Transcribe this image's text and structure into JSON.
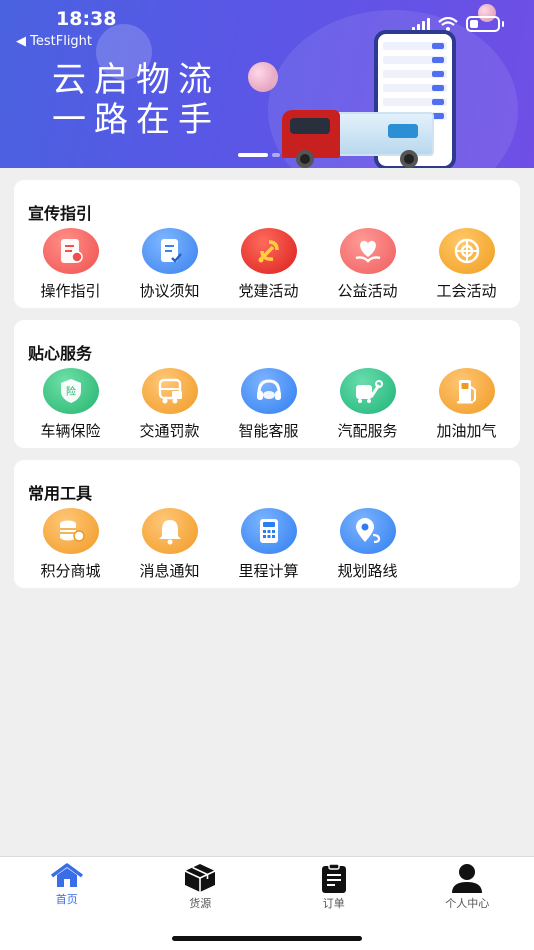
{
  "status_bar": {
    "time": "18:38",
    "back_app": "◀ TestFlight"
  },
  "banner": {
    "line1": "云启物流",
    "line2": "一路在手"
  },
  "sections": [
    {
      "title": "宣传指引",
      "items": [
        {
          "label": "操作指引",
          "icon": "guide-icon",
          "color": "#f25a5a"
        },
        {
          "label": "协议须知",
          "icon": "agreement-icon",
          "color": "#3f8df0"
        },
        {
          "label": "党建活动",
          "icon": "party-emblem-icon",
          "color": "#e8332c"
        },
        {
          "label": "公益活动",
          "icon": "charity-heart-icon",
          "color": "#f06565"
        },
        {
          "label": "工会活动",
          "icon": "union-emblem-icon",
          "color": "#f2a531"
        }
      ]
    },
    {
      "title": "贴心服务",
      "items": [
        {
          "label": "车辆保险",
          "icon": "insurance-shield-icon",
          "color": "#34c27e"
        },
        {
          "label": "交通罚款",
          "icon": "traffic-fine-icon",
          "color": "#f4a437"
        },
        {
          "label": "智能客服",
          "icon": "headset-icon",
          "color": "#3d88f2"
        },
        {
          "label": "汽配服务",
          "icon": "auto-parts-icon",
          "color": "#2fc38a"
        },
        {
          "label": "加油加气",
          "icon": "fuel-pump-icon",
          "color": "#f2a23a"
        }
      ]
    },
    {
      "title": "常用工具",
      "items": [
        {
          "label": "积分商城",
          "icon": "coins-icon",
          "color": "#f4a437"
        },
        {
          "label": "消息通知",
          "icon": "bell-icon",
          "color": "#f4a437"
        },
        {
          "label": "里程计算",
          "icon": "calculator-icon",
          "color": "#3d88f2"
        },
        {
          "label": "规划路线",
          "icon": "route-pin-icon",
          "color": "#3d88f2"
        }
      ]
    }
  ],
  "tabbar": [
    {
      "label": "首页",
      "icon": "home-icon",
      "active": true
    },
    {
      "label": "货源",
      "icon": "cargo-box-icon",
      "active": false
    },
    {
      "label": "订单",
      "icon": "order-clipboard-icon",
      "active": false
    },
    {
      "label": "个人中心",
      "icon": "user-icon",
      "active": false
    }
  ],
  "colors": {
    "accent": "#3a6ee8",
    "banner": "#5a56e6"
  }
}
